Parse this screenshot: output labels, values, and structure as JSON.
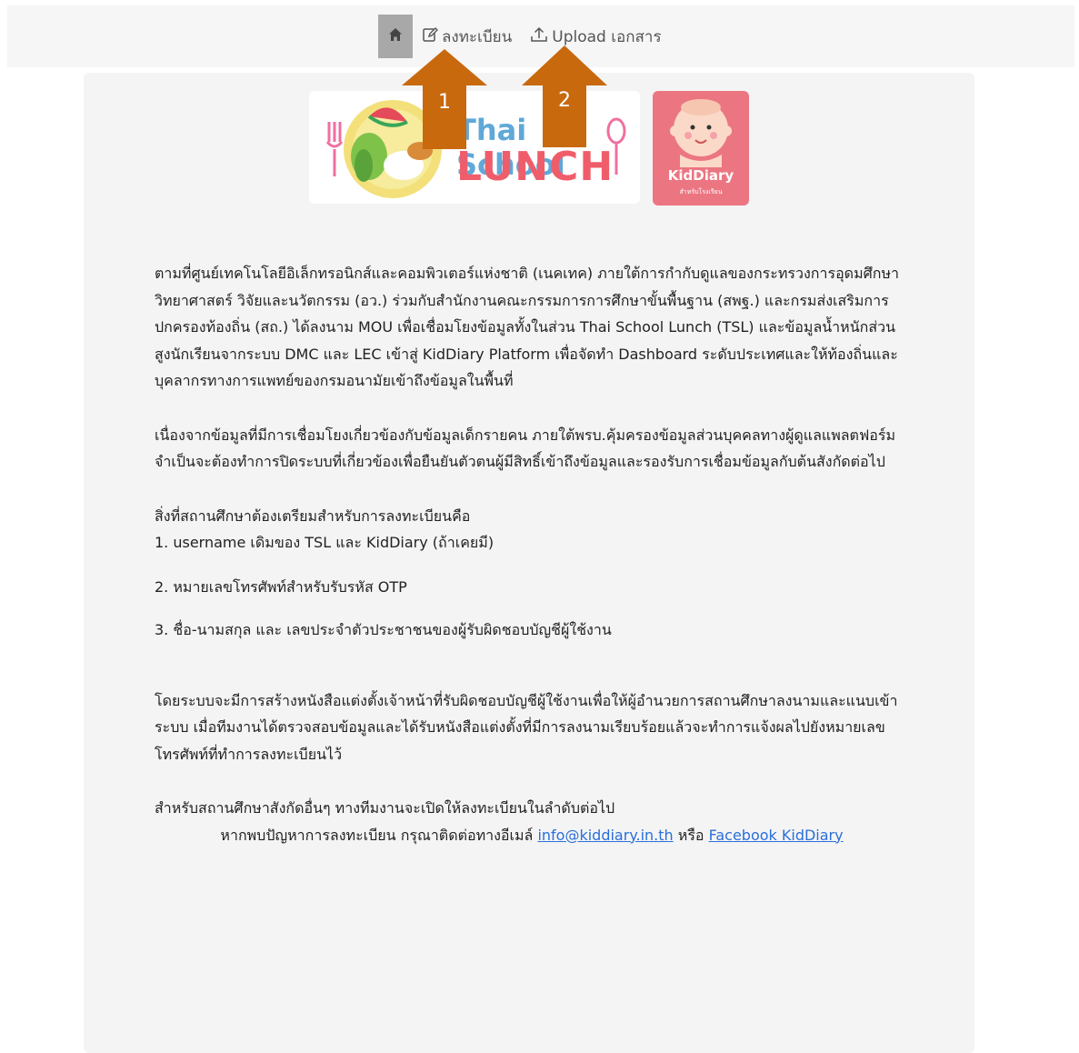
{
  "nav": {
    "home_icon": "home-icon",
    "register_icon": "edit-icon",
    "register_label": "ลงทะเบียน",
    "upload_icon": "upload-icon",
    "upload_label": "Upload เอกสาร"
  },
  "annotations": {
    "arrow1_label": "1",
    "arrow2_label": "2",
    "arrow_color": "#c8690e"
  },
  "logos": {
    "tsl_title": "Thai School",
    "tsl_lunch": "LUNCH",
    "kid_title": "KidDiary",
    "kid_subtitle": "สำหรับโรงเรียน"
  },
  "content": {
    "p1": "ตามที่ศูนย์เทคโนโลยีอิเล็กทรอนิกส์และคอมพิวเตอร์แห่งชาติ (เนคเทค) ภายใต้การกำกับดูแลของกระทรวงการอุดมศึกษา วิทยาศาสตร์ วิจัยและนวัตกรรม (อว.) ร่วมกับสำนักงานคณะกรรมการการศึกษาขั้นพื้นฐาน (สพฐ.) และกรมส่งเสริมการปกครองท้องถิ่น (สถ.) ได้ลงนาม MOU เพื่อเชื่อมโยงข้อมูลทั้งในส่วน Thai School Lunch (TSL) และข้อมูลน้ำหนักส่วนสูงนักเรียนจากระบบ DMC และ LEC เข้าสู่ KidDiary Platform เพื่อจัดทำ Dashboard ระดับประเทศและให้ท้องถิ่นและบุคลากรทางการแพทย์ของกรมอนามัยเข้าถึงข้อมูลในพื้นที่",
    "p2": "เนื่องจากข้อมูลที่มีการเชื่อมโยงเกี่ยวข้องกับข้อมูลเด็กรายคน ภายใต้พรบ.คุ้มครองข้อมูลส่วนบุคคลทางผู้ดูแลแพลตฟอร์มจำเป็นจะต้องทำการปิดระบบที่เกี่ยวข้องเพื่อยืนยันตัวตนผู้มีสิทธิ์เข้าถึงข้อมูลและรองรับการเชื่อมข้อมูลกับต้นสังกัดต่อไป",
    "prep_heading": "สิ่งที่สถานศึกษาต้องเตรียมสำหรับการลงทะเบียนคือ",
    "item1": "1. username เดิมของ TSL และ KidDiary (ถ้าเคยมี)",
    "item2": "2. หมายเลขโทรศัพท์สำหรับรับรหัส OTP",
    "item3": "3. ชื่อ-นามสกุล และ เลขประจำตัวประชาชนของผู้รับผิดชอบบัญชีผู้ใช้งาน",
    "p3": "โดยระบบจะมีการสร้างหนังสือแต่งตั้งเจ้าหน้าที่รับผิดชอบบัญชีผู้ใช้งานเพื่อให้ผู้อำนวยการสถานศึกษาลงนามและแนบเข้าระบบ เมื่อทีมงานได้ตรวจสอบข้อมูลและได้รับหนังสือแต่งตั้งที่มีการลงนามเรียบร้อยแล้วจะทำการแจ้งผลไปยังหมายเลขโทรศัพท์ที่ทำการลงทะเบียนไว้",
    "p4": "สำหรับสถานศึกษาสังกัดอื่นๆ ทางทีมงานจะเปิดให้ลงทะเบียนในลำดับต่อไป",
    "contact_prefix": "หากพบปัญหาการลงทะเบียน กรุณาติดต่อทางอีเมล์",
    "contact_email": "info@kiddiary.in.th",
    "contact_or": "หรือ",
    "contact_facebook": "Facebook KidDiary"
  }
}
